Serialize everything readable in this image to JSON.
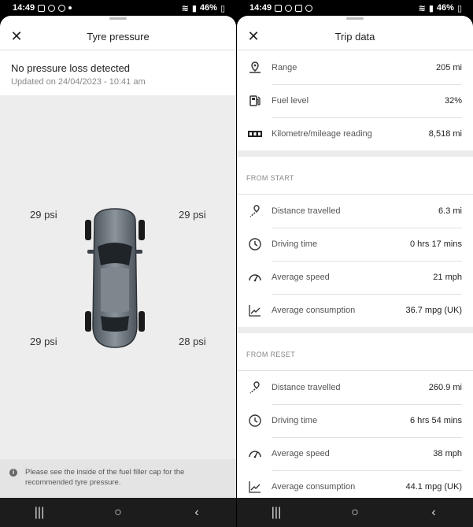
{
  "status_bar": {
    "time_left": "14:49",
    "time_right": "14:49",
    "battery_left": "46%",
    "battery_right": "46%"
  },
  "tyre": {
    "title": "Tyre pressure",
    "status": "No pressure loss detected",
    "updated": "Updated on 24/04/2023 - 10:41 am",
    "front_left": "29 psi",
    "front_right": "29 psi",
    "rear_left": "29 psi",
    "rear_right": "28 psi",
    "note": "Please see the inside of the fuel filler cap for the recommended tyre pressure."
  },
  "trip": {
    "title": "Trip data",
    "summary": [
      {
        "icon": "range-pin-icon",
        "label": "Range",
        "value": "205 mi"
      },
      {
        "icon": "fuel-pump-icon",
        "label": "Fuel level",
        "value": "32%"
      },
      {
        "icon": "odometer-icon",
        "label": "Kilometre/mileage reading",
        "value": "8,518 mi"
      }
    ],
    "from_start": {
      "heading": "FROM START",
      "rows": [
        {
          "icon": "distance-icon",
          "label": "Distance travelled",
          "value": "6.3 mi"
        },
        {
          "icon": "clock-icon",
          "label": "Driving time",
          "value": "0 hrs 17 mins"
        },
        {
          "icon": "speedometer-icon",
          "label": "Average speed",
          "value": "21 mph"
        },
        {
          "icon": "consumption-graph-icon",
          "label": "Average consumption",
          "value": "36.7 mpg (UK)"
        }
      ]
    },
    "from_reset": {
      "heading": "FROM RESET",
      "rows": [
        {
          "icon": "distance-icon",
          "label": "Distance travelled",
          "value": "260.9 mi"
        },
        {
          "icon": "clock-icon",
          "label": "Driving time",
          "value": "6 hrs 54 mins"
        },
        {
          "icon": "speedometer-icon",
          "label": "Average speed",
          "value": "38 mph"
        },
        {
          "icon": "consumption-graph-icon",
          "label": "Average consumption",
          "value": "44.1 mpg (UK)"
        }
      ]
    }
  },
  "nav": {
    "recents": "|||",
    "home": "○",
    "back": "‹"
  },
  "colors": {
    "sheet_bg": "#ffffff",
    "tyre_area_bg": "#ededed",
    "navbar_bg": "#1c1c1c"
  }
}
